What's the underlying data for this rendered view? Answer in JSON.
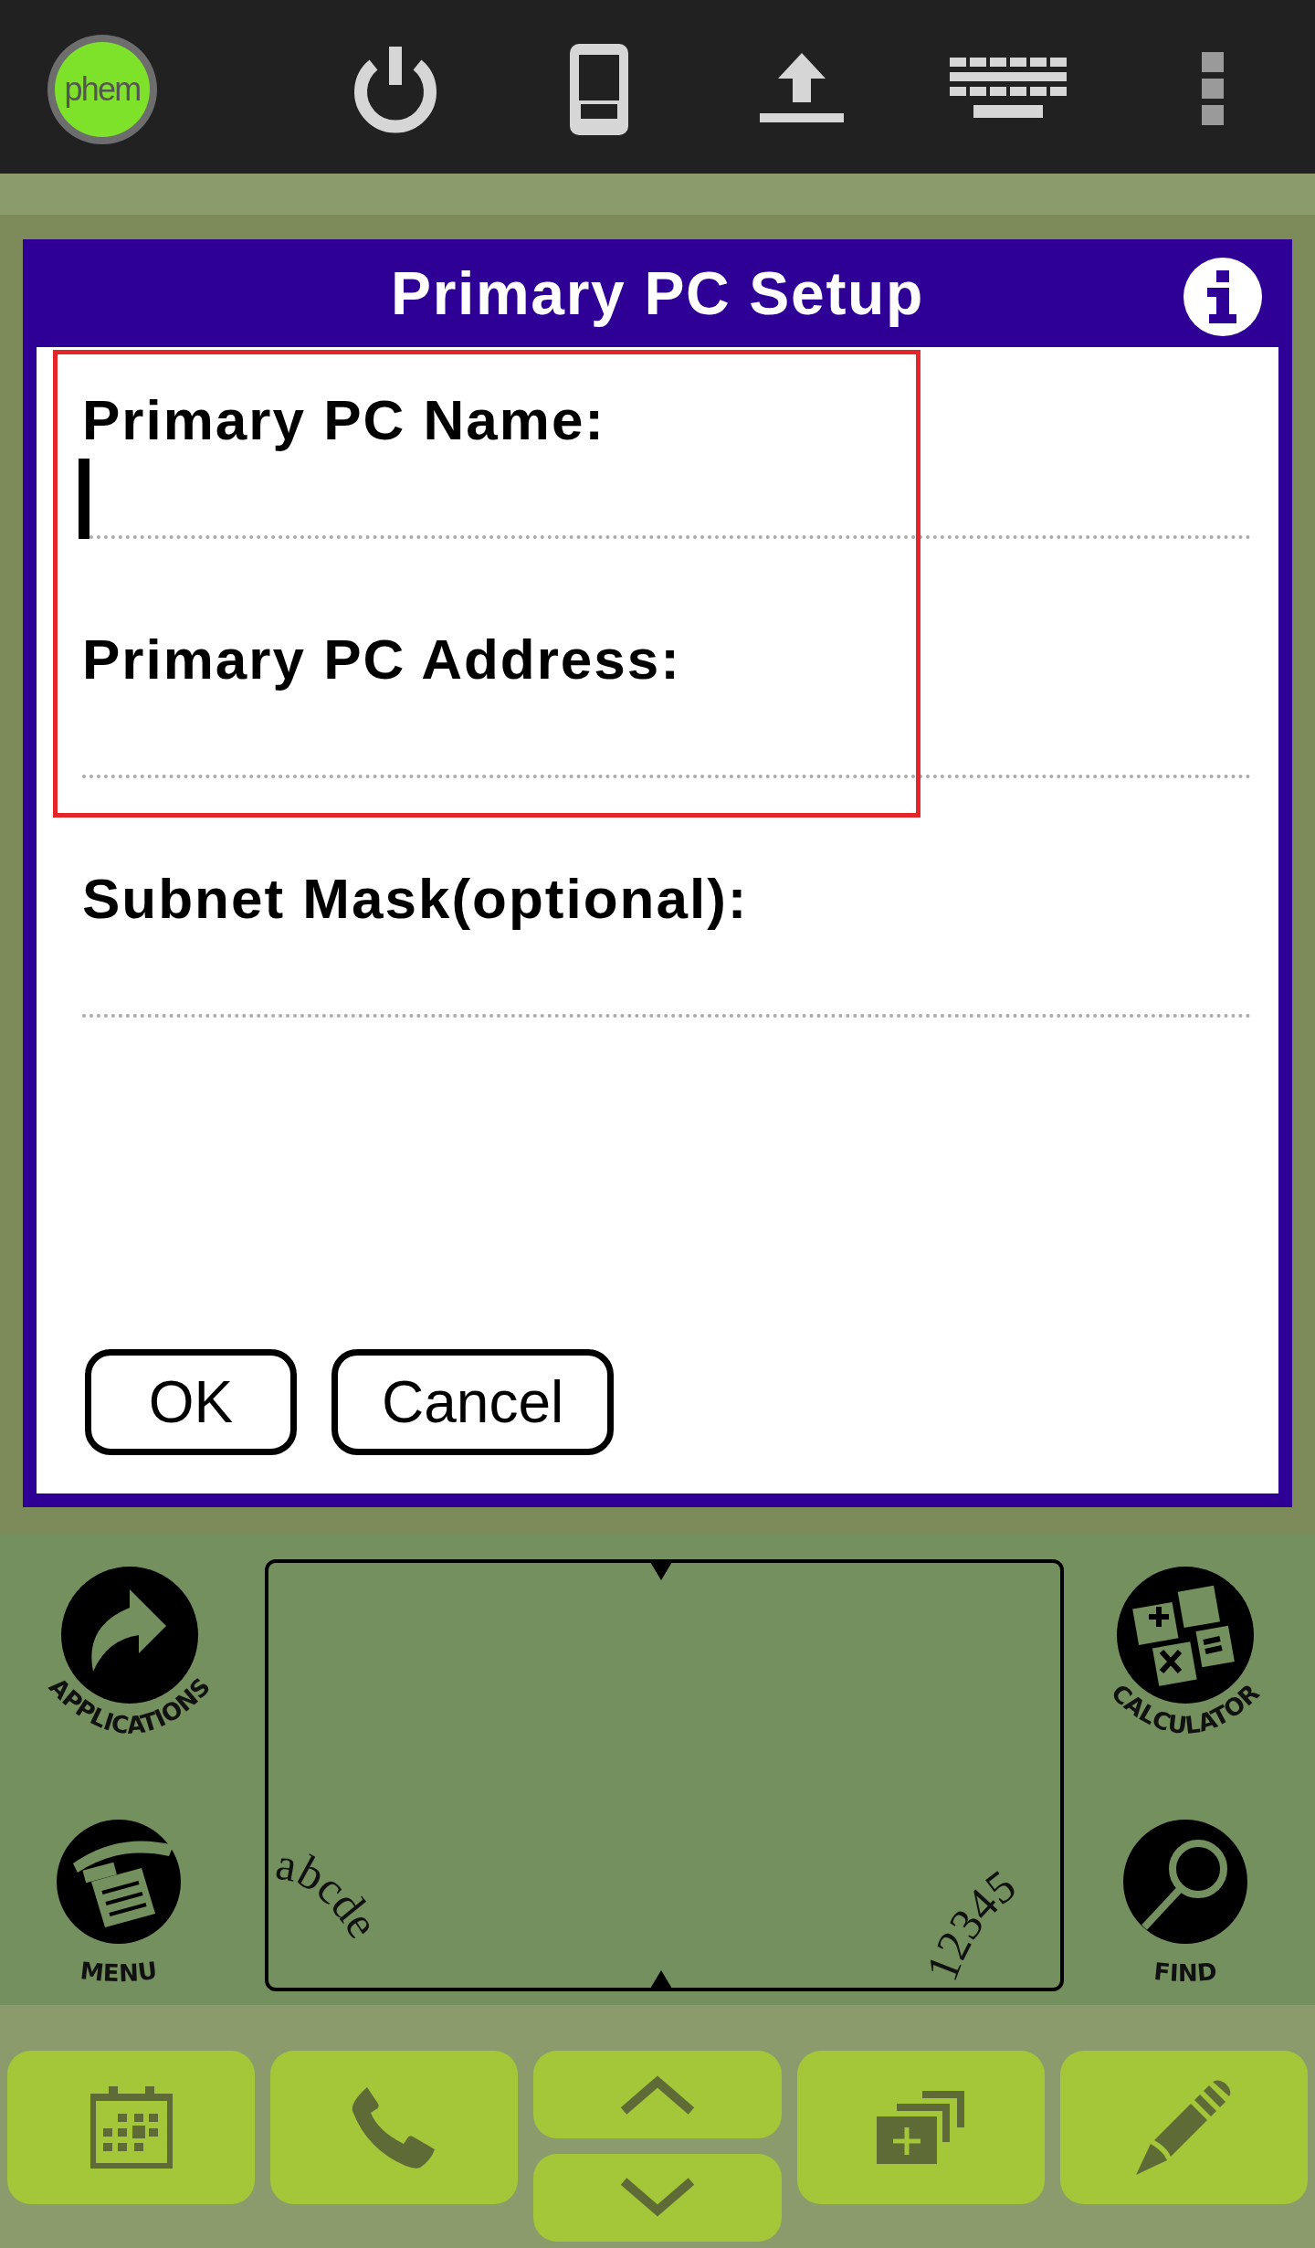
{
  "top_bar": {
    "logo": "phem"
  },
  "dialog": {
    "title": "Primary PC Setup",
    "fields": [
      {
        "label": "Primary PC Name:",
        "focused": true
      },
      {
        "label": "Primary PC Address:",
        "focused": false
      },
      {
        "label": "Subnet Mask(optional):",
        "focused": false
      }
    ],
    "buttons": [
      "OK",
      "Cancel"
    ]
  },
  "silkscreen": {
    "left": [
      "APPLICATIONS",
      "MENU"
    ],
    "right": [
      "CALCULATOR",
      "FIND"
    ],
    "letters_hint": "abcde",
    "numbers_hint": "12345"
  }
}
